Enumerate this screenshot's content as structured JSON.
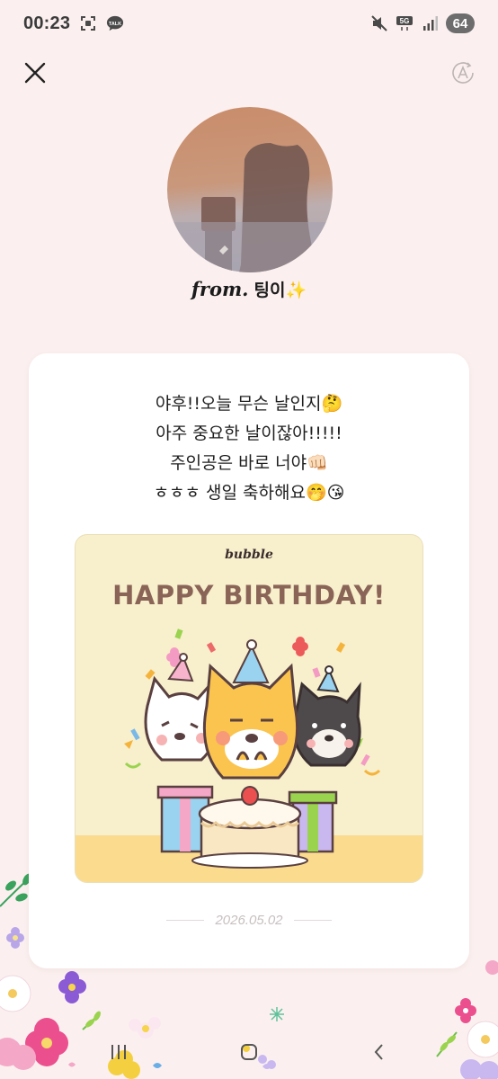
{
  "status_bar": {
    "time": "00:23",
    "battery": "64",
    "network": "5G"
  },
  "sender": {
    "from_label": "from.",
    "name": "팅이✨"
  },
  "message": {
    "lines": [
      "야후!!오늘 무슨 날인지🤔",
      "아주 중요한 날이잖아!!!!!",
      "주인공은 바로 너야👊🏻",
      "ㅎㅎㅎ 생일 축하해요🤭😘"
    ]
  },
  "greeting_card": {
    "brand": "bubble",
    "title": "HAPPY BIRTHDAY!"
  },
  "date": "2026.05.02",
  "colors": {
    "background": "#fbf0ef",
    "card": "#ffffff",
    "card_art_bg": "#f8efcc",
    "title_brown": "#8a6557"
  },
  "icons": {
    "close": "close-icon",
    "translate": "translate-icon",
    "nav_recent": "recent-apps-icon",
    "nav_home": "home-icon",
    "nav_back": "back-icon"
  }
}
